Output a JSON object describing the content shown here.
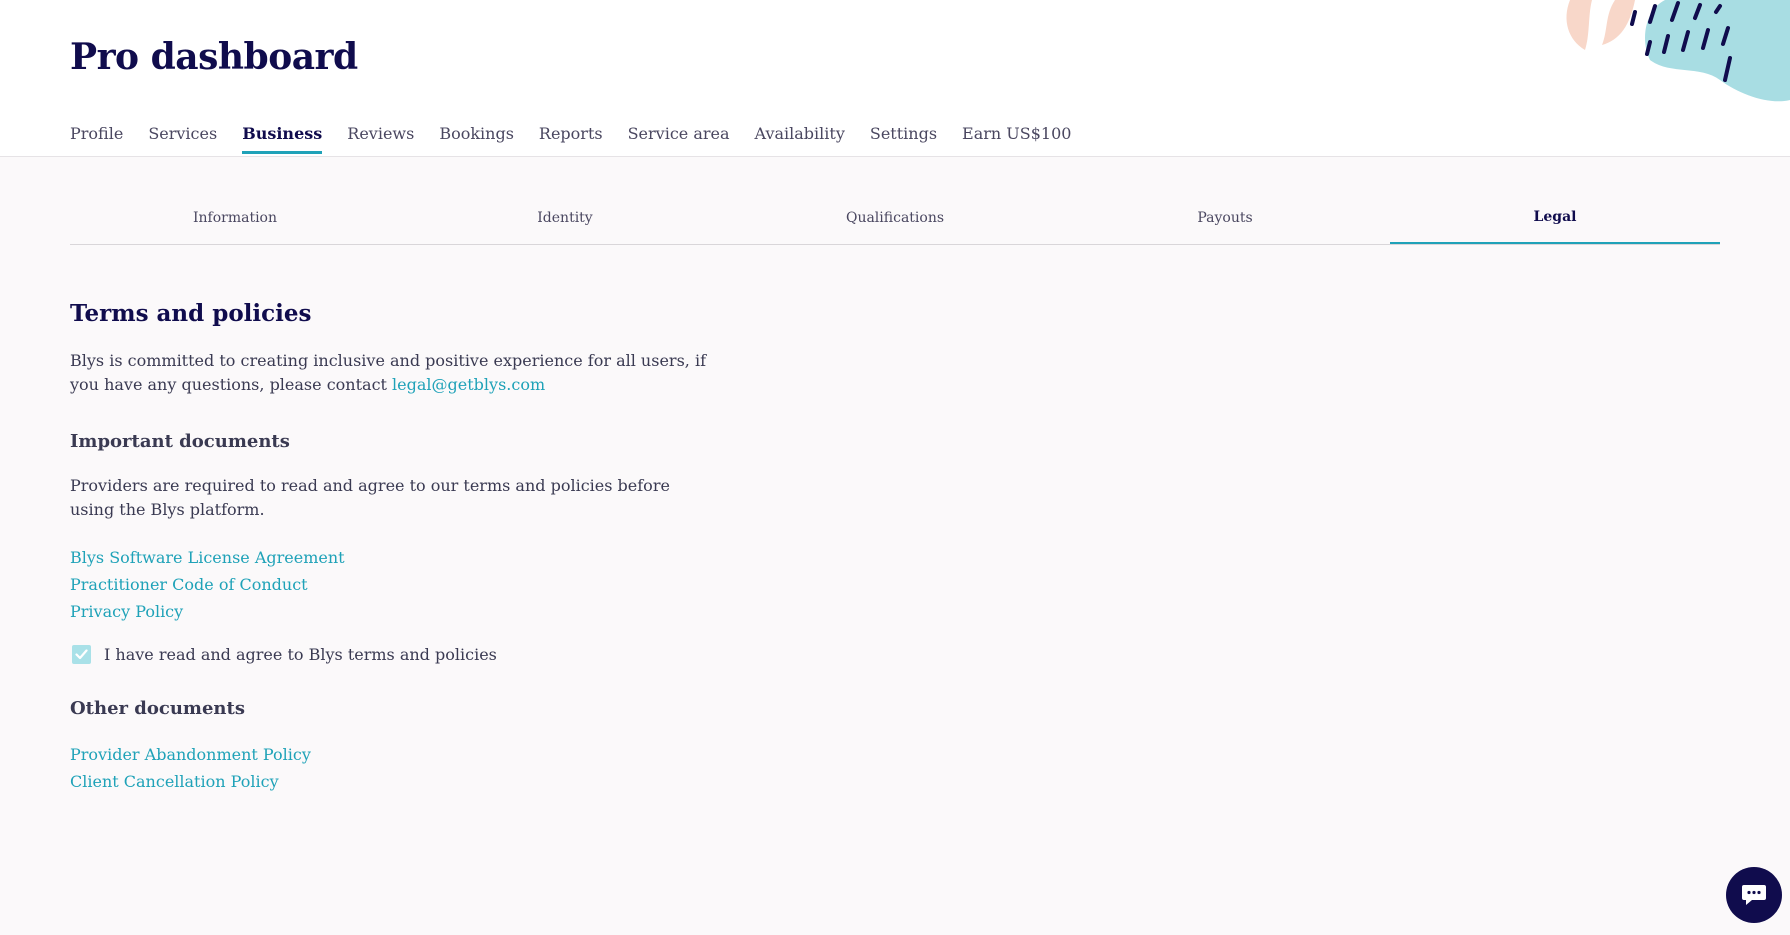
{
  "header": {
    "title": "Pro dashboard"
  },
  "nav": {
    "tabs": [
      {
        "label": "Profile"
      },
      {
        "label": "Services"
      },
      {
        "label": "Business"
      },
      {
        "label": "Reviews"
      },
      {
        "label": "Bookings"
      },
      {
        "label": "Reports"
      },
      {
        "label": "Service area"
      },
      {
        "label": "Availability"
      },
      {
        "label": "Settings"
      },
      {
        "label": "Earn US$100"
      }
    ],
    "active": "Business"
  },
  "sub_tabs": {
    "items": [
      {
        "label": "Information"
      },
      {
        "label": "Identity"
      },
      {
        "label": "Qualifications"
      },
      {
        "label": "Payouts"
      },
      {
        "label": "Legal"
      }
    ],
    "active": "Legal"
  },
  "legal": {
    "title": "Terms and policies",
    "intro_text": "Blys is committed to creating inclusive and positive experience for all users, if you have any questions, please contact ",
    "contact_email": "legal@getblys.com",
    "important_heading": "Important documents",
    "important_text": "Providers are required to read and agree to our terms and policies before using the Blys platform.",
    "important_links": [
      {
        "label": "Blys Software License Agreement"
      },
      {
        "label": "Practitioner Code of Conduct"
      },
      {
        "label": "Privacy Policy"
      }
    ],
    "agree_label": "I have read and agree to Blys terms and policies",
    "agree_checked": true,
    "other_heading": "Other documents",
    "other_links": [
      {
        "label": "Provider Abandonment Policy"
      },
      {
        "label": "Client Cancellation Policy"
      }
    ]
  },
  "colors": {
    "brand_dark": "#100c4d",
    "accent": "#1fa2b8",
    "checkbox_fill": "#a9e1e8"
  },
  "icons": {
    "chat": "chat-bubble-icon",
    "check": "check-icon"
  }
}
